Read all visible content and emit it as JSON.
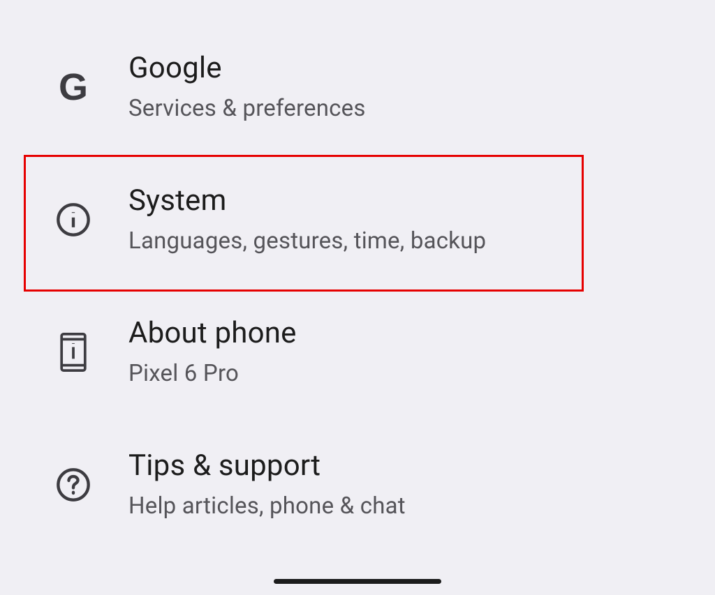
{
  "settings": {
    "items": [
      {
        "title": "Google",
        "subtitle": "Services & preferences"
      },
      {
        "title": "System",
        "subtitle": "Languages, gestures, time, backup"
      },
      {
        "title": "About phone",
        "subtitle": "Pixel 6 Pro"
      },
      {
        "title": "Tips & support",
        "subtitle": "Help articles, phone & chat"
      }
    ]
  }
}
